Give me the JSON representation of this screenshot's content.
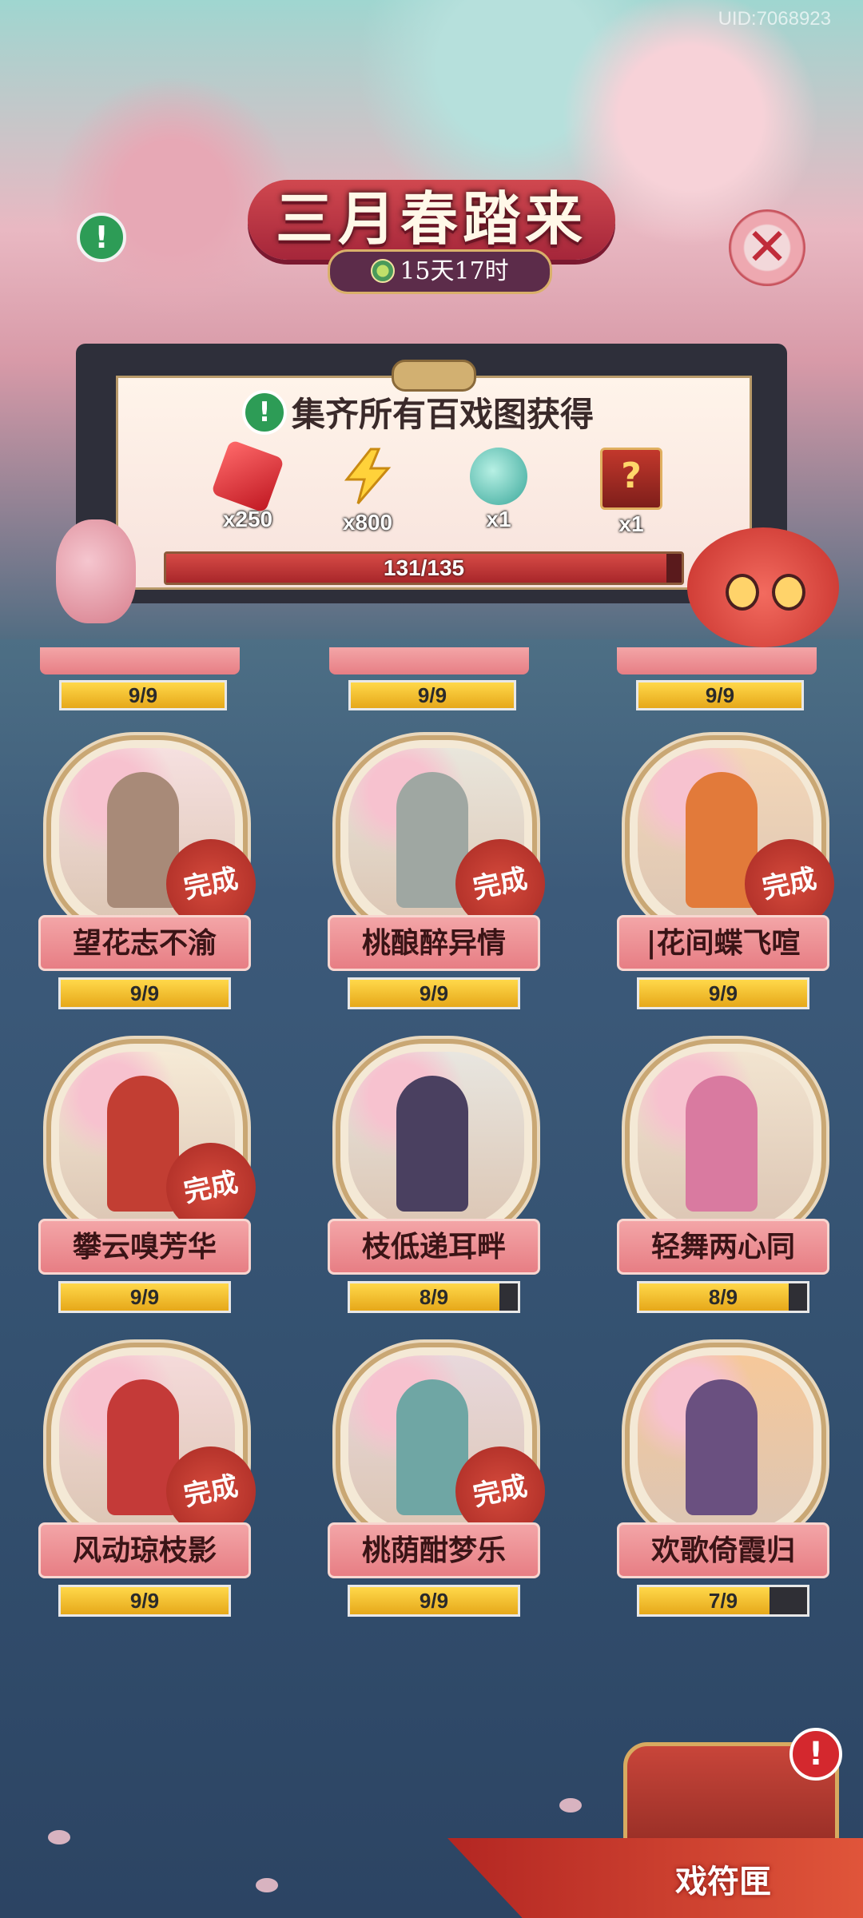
{
  "header": {
    "uid": "UID:7068923",
    "title": "三月春踏来",
    "timer": "15天17时"
  },
  "panel": {
    "title": "集齐所有百戏图获得",
    "rewards": [
      {
        "icon": "red-gem-icon",
        "qty": "x250"
      },
      {
        "icon": "lightning-bolt-icon",
        "qty": "x800"
      },
      {
        "icon": "jade-pouch-icon",
        "qty": "x1"
      },
      {
        "icon": "mystery-box-icon",
        "qty": "x1"
      }
    ],
    "progress": {
      "text": "131/135",
      "current": 131,
      "total": 135
    }
  },
  "partial_row": [
    {
      "progress": "9/9",
      "fraction": 1.0
    },
    {
      "progress": "9/9",
      "fraction": 1.0
    },
    {
      "progress": "9/9",
      "fraction": 1.0
    }
  ],
  "cards": [
    {
      "name": "望花志不渝",
      "progress": "9/9",
      "fraction": 1.0,
      "complete": true,
      "stamp": "完成"
    },
    {
      "name": "桃酿醉异情",
      "progress": "9/9",
      "fraction": 1.0,
      "complete": true,
      "stamp": "完成"
    },
    {
      "name": "|花间蝶飞喧",
      "progress": "9/9",
      "fraction": 1.0,
      "complete": true,
      "stamp": "完成"
    },
    {
      "name": "攀云嗅芳华",
      "progress": "9/9",
      "fraction": 1.0,
      "complete": true,
      "stamp": "完成"
    },
    {
      "name": "枝低递耳畔",
      "progress": "8/9",
      "fraction": 0.889,
      "complete": false,
      "stamp": ""
    },
    {
      "name": "轻舞两心同",
      "progress": "8/9",
      "fraction": 0.889,
      "complete": false,
      "stamp": ""
    },
    {
      "name": "风动琼枝影",
      "progress": "9/9",
      "fraction": 1.0,
      "complete": true,
      "stamp": "完成"
    },
    {
      "name": "桃荫酣梦乐",
      "progress": "9/9",
      "fraction": 1.0,
      "complete": true,
      "stamp": "完成"
    },
    {
      "name": "欢歌倚霞归",
      "progress": "7/9",
      "fraction": 0.778,
      "complete": false,
      "stamp": ""
    }
  ],
  "chest": {
    "label": "戏符匣",
    "alert": "!"
  },
  "colors": {
    "accent_red": "#c02c3a",
    "progress_gold": "#ffd84a",
    "info_green": "#2d9c56"
  }
}
